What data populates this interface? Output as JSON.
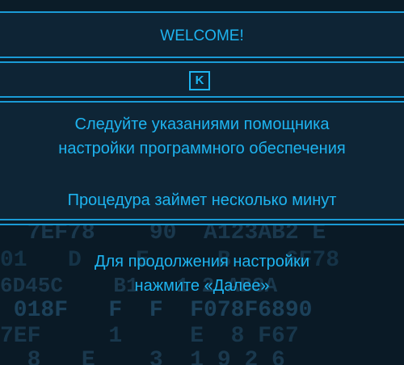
{
  "header": {
    "title": "WELCOME!"
  },
  "logo": {
    "letter": "K"
  },
  "info": {
    "line1": "Следуйте указаниями помощника",
    "line2": "настройки программного обеспечения",
    "line3": "Процедура займет несколько минут"
  },
  "footer": {
    "line1": "Для продолжения настройки",
    "line2": "нажмите «Далее»"
  },
  "background_code": [
    "  7EF78    90  A123AB2 E",
    "01   D    E     B    6F78",
    "6D45C    B1   1 2 AB3A",
    " 018F   F  F  F078F6890",
    "7EF     1     E  8 F67",
    "  8   E    3  1 9 2 6"
  ],
  "colors": {
    "accent": "#1eb4f0",
    "border": "#1a9bd6",
    "background": "#0b1c28"
  }
}
